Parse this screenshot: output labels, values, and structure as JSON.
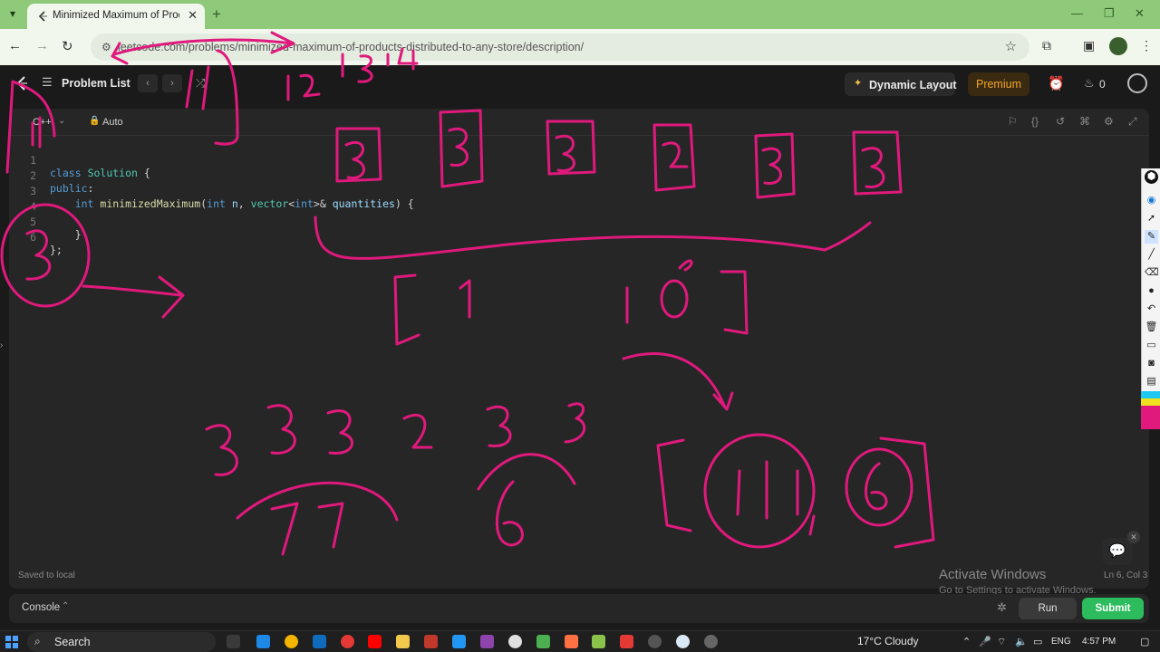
{
  "browser": {
    "tab_title": "Minimized Maximum of Products",
    "url": "leetcode.com/problems/minimized-maximum-of-products-distributed-to-any-store/description/"
  },
  "header": {
    "problem_list_label": "Problem List",
    "dynamic_layout_label": "Dynamic Layout",
    "premium_label": "Premium",
    "streak_count": "0"
  },
  "editor": {
    "language": "C++",
    "autosave_mode": "Auto",
    "lines": [
      {
        "num": "1",
        "text": "class Solution {"
      },
      {
        "num": "2",
        "text": "public:"
      },
      {
        "num": "3",
        "text": "    int minimizedMaximum(int n, vector<int>& quantities) {"
      },
      {
        "num": "4",
        "text": ""
      },
      {
        "num": "5",
        "text": "    }"
      },
      {
        "num": "6",
        "text": "};"
      }
    ],
    "saved_status": "Saved to local",
    "cursor_position": "Ln 6, Col 3"
  },
  "console": {
    "label": "Console",
    "run_label": "Run",
    "submit_label": "Submit"
  },
  "watermark": {
    "title": "Activate Windows",
    "subtitle": "Go to Settings to activate Windows."
  },
  "taskbar": {
    "search_label": "Search",
    "weather": "17°C  Cloudy",
    "language": "ENG",
    "time": "4:57 PM"
  },
  "colors": {
    "annotation_ink": "#e0197d",
    "submit_green": "#2cbb5d",
    "premium_orange": "#f5a623",
    "browser_frame": "#8fc97a"
  }
}
